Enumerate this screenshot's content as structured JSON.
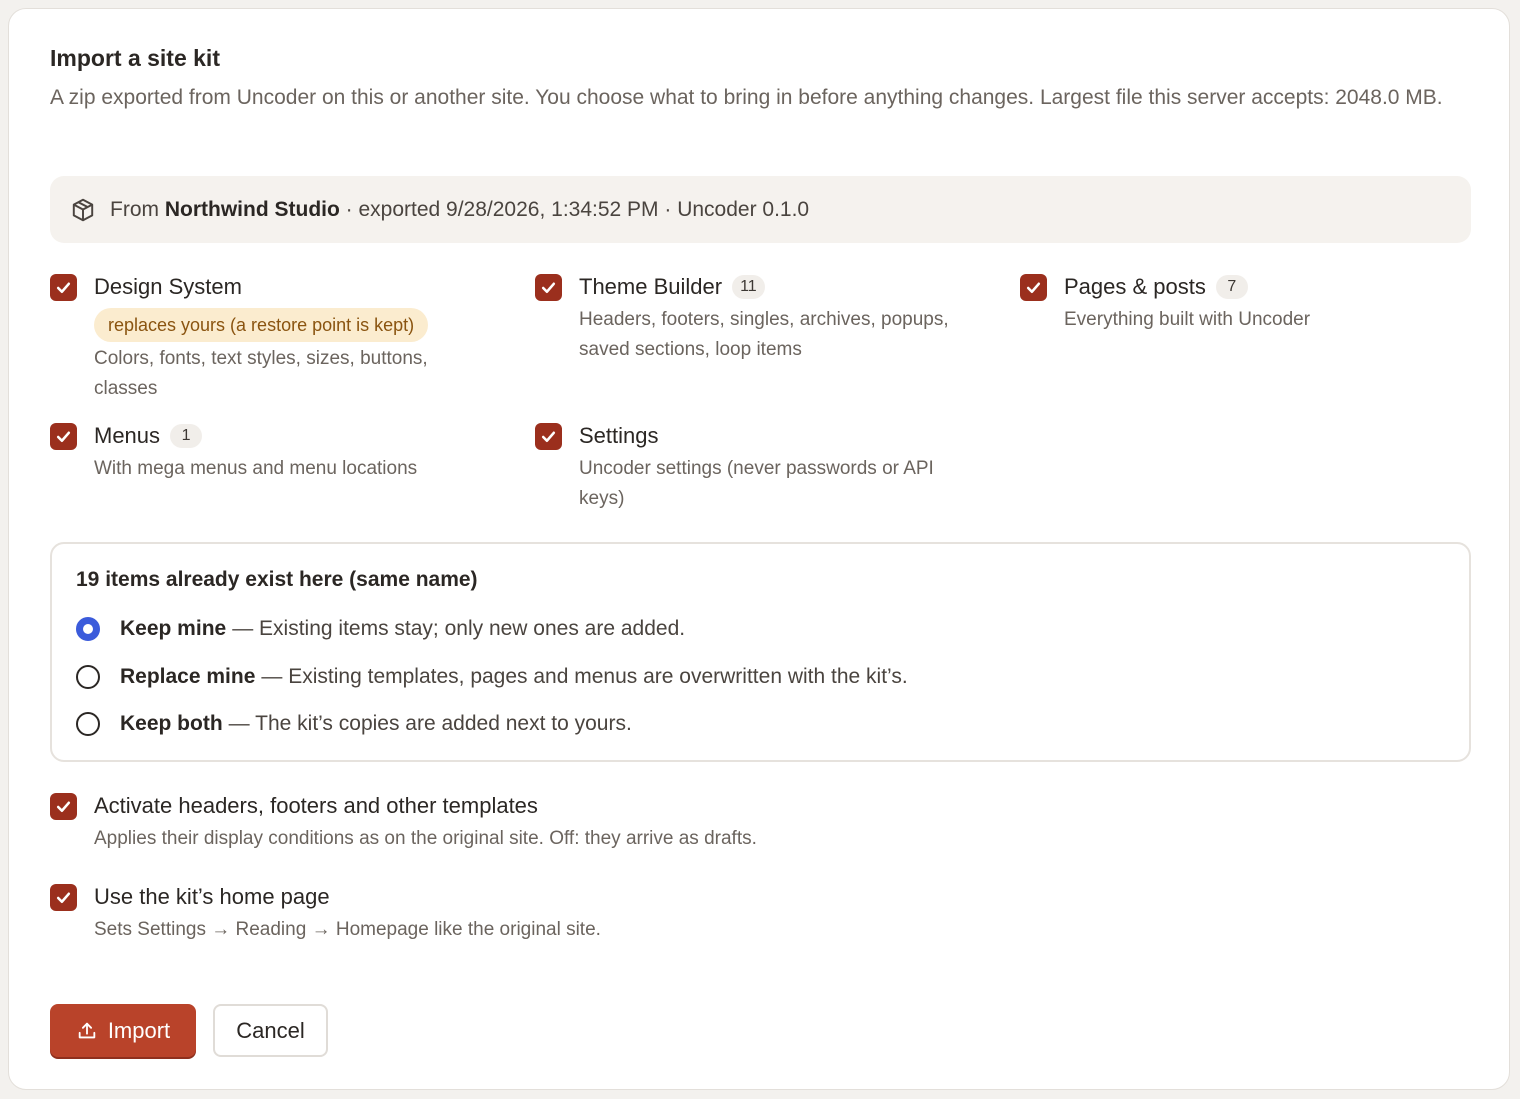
{
  "header": {
    "title": "Import a site kit",
    "description": "A zip exported from Uncoder on this or another site. You choose what to bring in before anything changes. Largest file this server accepts: 2048.0 MB."
  },
  "source": {
    "icon": "package-icon",
    "prefix": "From",
    "site_name": "Northwind Studio",
    "details": "· exported 9/28/2026, 1:34:52 PM · Uncoder 0.1.0"
  },
  "parts": [
    {
      "label": "Design System",
      "count": null,
      "checked": true,
      "warning": "replaces yours (a restore point is kept)",
      "description": "Colors, fonts, text styles, sizes, buttons, classes"
    },
    {
      "label": "Theme Builder",
      "count": "11",
      "checked": true,
      "description": "Headers, footers, singles, archives, popups, saved sections, loop items"
    },
    {
      "label": "Pages & posts",
      "count": "7",
      "checked": true,
      "description": "Everything built with Uncoder"
    },
    {
      "label": "Menus",
      "count": "1",
      "checked": true,
      "description": "With mega menus and menu locations"
    },
    {
      "label": "Settings",
      "count": null,
      "checked": true,
      "description": "Uncoder settings (never passwords or API keys)"
    }
  ],
  "conflicts": {
    "title": "19 items already exist here (same name)",
    "options": [
      {
        "label": "Keep mine",
        "description": "— Existing items stay; only new ones are added.",
        "selected": true
      },
      {
        "label": "Replace mine",
        "description": "— Existing templates, pages and menus are overwritten with the kit’s.",
        "selected": false
      },
      {
        "label": "Keep both",
        "description": "— The kit’s copies are added next to yours.",
        "selected": false
      }
    ]
  },
  "extras": [
    {
      "label": "Activate headers, footers and other templates",
      "description": "Applies their display conditions as on the original site. Off: they arrive as drafts.",
      "checked": true
    },
    {
      "label": "Use the kit’s home page",
      "description": "Sets Settings → Reading → Homepage like the original site.",
      "checked": true
    }
  ],
  "actions": {
    "import_label": "Import",
    "cancel_label": "Cancel"
  },
  "colors": {
    "accent": "#9b2f1d",
    "primary_button": "#b9432a",
    "radio_selected": "#3b5bdb",
    "warning_bg": "#fbeccf",
    "warning_text": "#8a5410"
  }
}
